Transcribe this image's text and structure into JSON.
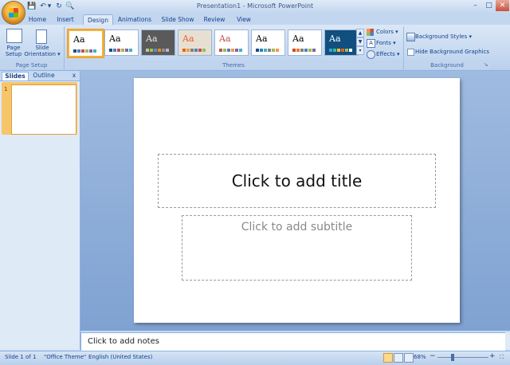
{
  "window": {
    "title": "Presentation1 - Microsoft PowerPoint",
    "min": "–",
    "max": "□",
    "close": "✕"
  },
  "qat": {
    "save": "💾",
    "undo": "↶",
    "dropdown": "▾",
    "redo": "↻",
    "preview": "🔍"
  },
  "ribbon_tabs": [
    "Home",
    "Insert",
    "Design",
    "Animations",
    "Slide Show",
    "Review",
    "View"
  ],
  "page_setup": {
    "page_setup_label": "Page\nSetup",
    "orientation_label": "Slide\nOrientation ▾",
    "group": "Page Setup"
  },
  "themes": {
    "group": "Themes",
    "items": [
      {
        "aa": "Aa",
        "bg": "#ffffff",
        "fg": "#000000",
        "selected": true,
        "swatches": [
          "#1f497d",
          "#4f81bd",
          "#c0504d",
          "#9bbb59",
          "#8064a2",
          "#4bacc6"
        ]
      },
      {
        "aa": "Aa",
        "bg": "#ffffff",
        "fg": "#000000",
        "selected": false,
        "swatches": [
          "#1f497d",
          "#4f81bd",
          "#c0504d",
          "#9bbb59",
          "#8064a2",
          "#4bacc6"
        ]
      },
      {
        "aa": "Aa",
        "bg": "#5a5a5a",
        "fg": "#e8e8e8",
        "selected": false,
        "swatches": [
          "#b6c7a3",
          "#a5c249",
          "#5a8fc0",
          "#e38d2b",
          "#909090",
          "#c0b0d0"
        ]
      },
      {
        "aa": "Aa",
        "bg": "#e7e0d2",
        "fg": "#e96028",
        "selected": false,
        "swatches": [
          "#e96028",
          "#f0a040",
          "#7f7f7f",
          "#4f81bd",
          "#c0504d",
          "#9bbb59"
        ]
      },
      {
        "aa": "Aa",
        "bg": "#ffffff",
        "fg": "#c0504d",
        "selected": false,
        "swatches": [
          "#c0504d",
          "#9bbb59",
          "#4f81bd",
          "#f79646",
          "#8064a2",
          "#4bacc6"
        ]
      },
      {
        "aa": "Aa",
        "bg": "#ffffff",
        "fg": "#000000",
        "selected": false,
        "swatches": [
          "#1f497d",
          "#2f7fc1",
          "#4bacc6",
          "#7f7f7f",
          "#9bbb59",
          "#f79646"
        ]
      },
      {
        "aa": "Aa",
        "bg": "#ffffff",
        "fg": "#000000",
        "selected": false,
        "swatches": [
          "#d04a1a",
          "#e87a2a",
          "#7f7f7f",
          "#4f81bd",
          "#9bbb59",
          "#8064a2"
        ]
      },
      {
        "aa": "Aa",
        "bg": "#11507e",
        "fg": "#ffffff",
        "selected": false,
        "swatches": [
          "#3fa0d0",
          "#2fbf9f",
          "#f0c030",
          "#e06030",
          "#9bbb59",
          "#ffffff"
        ]
      }
    ],
    "scroll_up": "▲",
    "scroll_down": "▼",
    "more": "▾"
  },
  "theme_options": {
    "colors": "Colors ▾",
    "fonts": "Fonts ▾",
    "effects": "Effects ▾"
  },
  "background": {
    "styles": "Background Styles ▾",
    "hide": "Hide Background Graphics",
    "group": "Background",
    "launcher": "↘"
  },
  "left_pane": {
    "tab_slides": "Slides",
    "tab_outline": "Outline",
    "close": "x",
    "slide_number": "1"
  },
  "slide": {
    "title_placeholder": "Click to add title",
    "subtitle_placeholder": "Click to add subtitle"
  },
  "notes": {
    "placeholder": "Click to add notes"
  },
  "status": {
    "slide": "Slide 1 of 1",
    "theme": "\"Office Theme\"",
    "language": "English (United States)",
    "zoom": "68%",
    "zoom_minus": "−",
    "zoom_plus": "+",
    "fit": "⛶"
  }
}
